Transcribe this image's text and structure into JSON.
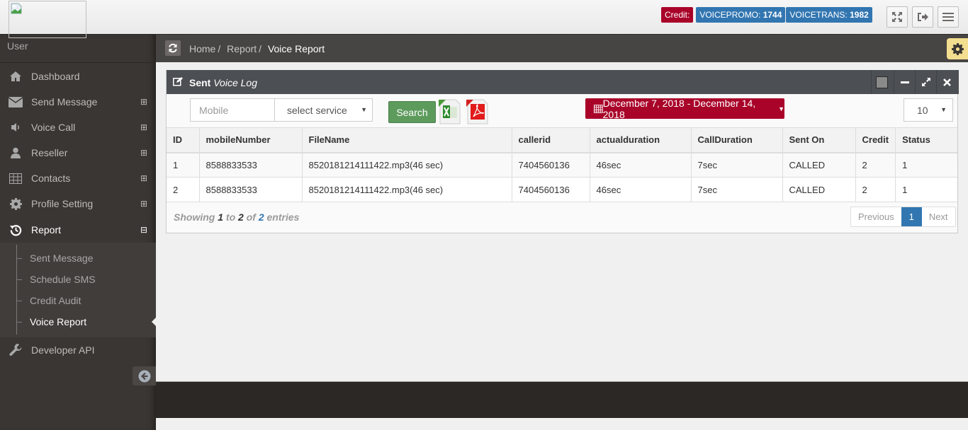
{
  "header": {
    "logo_alt": "",
    "credit_label": "Credit:",
    "credits": [
      {
        "name": "VOICEPROMO:",
        "value": "1744"
      },
      {
        "name": "VOICETRANS:",
        "value": "1982"
      }
    ],
    "buttons": [
      "fullscreen",
      "logout",
      "menu"
    ]
  },
  "sidebar": {
    "user_label": "User",
    "items": [
      {
        "label": "Dashboard",
        "icon": "home-icon",
        "expand": ""
      },
      {
        "label": "Send Message",
        "icon": "envelope-icon",
        "expand": "⊞"
      },
      {
        "label": "Voice Call",
        "icon": "volume-icon",
        "expand": "⊞"
      },
      {
        "label": "Reseller",
        "icon": "user-icon",
        "expand": "⊞"
      },
      {
        "label": "Contacts",
        "icon": "table-icon",
        "expand": "⊞"
      },
      {
        "label": "Profile Setting",
        "icon": "gear-icon",
        "expand": "⊞"
      },
      {
        "label": "Report",
        "icon": "history-icon",
        "expand": "⊟"
      },
      {
        "label": "Developer API",
        "icon": "wrench-icon",
        "expand": ""
      }
    ],
    "report_submenu": [
      {
        "label": "Sent Message"
      },
      {
        "label": "Schedule SMS"
      },
      {
        "label": "Credit Audit"
      },
      {
        "label": "Voice Report",
        "active": true
      }
    ]
  },
  "breadcrumb": {
    "items": [
      "Home",
      "Report"
    ],
    "separator": "/",
    "current": "Voice Report"
  },
  "widget": {
    "title_bold": "Sent",
    "title_italic": "Voice Log",
    "filters": {
      "mobile_placeholder": "Mobile",
      "mobile_value": "",
      "service_selected": "select service",
      "search_label": "Search",
      "export_excel": "CSV",
      "export_pdf": "PDF",
      "date_range": "December 7, 2018 - December 14, 2018",
      "page_length": "10"
    },
    "table": {
      "columns": [
        "ID",
        "mobileNumber",
        "FileName",
        "callerid",
        "actualduration",
        "CallDuration",
        "Sent On",
        "Credit",
        "Status"
      ],
      "rows": [
        [
          "1",
          "8588833533",
          "8520181214111422.mp3(46 sec)",
          "7404560136",
          "46sec",
          "7sec",
          "CALLED",
          "2",
          "1"
        ],
        [
          "2",
          "8588833533",
          "8520181214111422.mp3(46 sec)",
          "7404560136",
          "46sec",
          "7sec",
          "CALLED",
          "2",
          "1"
        ]
      ]
    },
    "info": {
      "prefix": "Showing",
      "from": "1",
      "to_word": "to",
      "to": "2",
      "of_word": "of",
      "total": "2",
      "suffix": "entries"
    },
    "pagination": {
      "previous": "Previous",
      "current": "1",
      "next": "Next"
    }
  },
  "colors": {
    "credit_red": "#a90329",
    "credit_blue": "#3276b1",
    "search_green": "#5d9b5d",
    "sidebar_bg": "#3a3633",
    "widget_header": "#4c4f53",
    "settings_yellow": "#f3de90"
  }
}
